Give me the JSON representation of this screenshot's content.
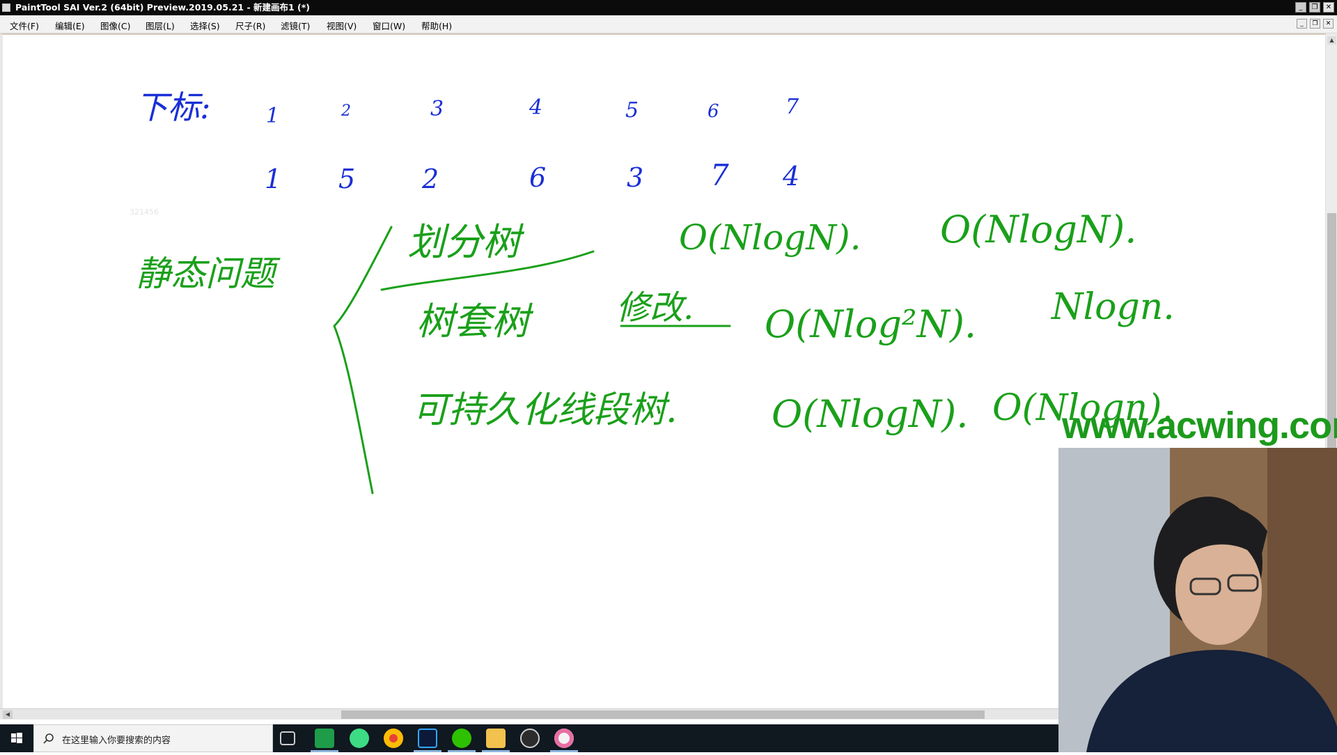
{
  "window": {
    "title": "PaintTool SAI Ver.2 (64bit) Preview.2019.05.21 - 新建画布1 (*)",
    "minimize_label": "_",
    "restore_label": "❐",
    "close_label": "✕"
  },
  "menu": {
    "items": [
      "文件(F)",
      "编辑(E)",
      "图像(C)",
      "图层(L)",
      "选择(S)",
      "尺子(R)",
      "滤镜(T)",
      "视图(V)",
      "窗口(W)",
      "帮助(H)"
    ]
  },
  "canvas": {
    "ink_color": "#1aa01a",
    "blue_ink_color": "#1a2fd6",
    "row1_label": "下标:",
    "row1_numbers": [
      "1",
      "2",
      "3",
      "4",
      "5",
      "6",
      "7"
    ],
    "row2_numbers": [
      "1",
      "5",
      "2",
      "6",
      "3",
      "7",
      "4"
    ],
    "faint_number": "321456",
    "static_label": "静态问题",
    "rows": [
      {
        "name": "划分树",
        "complexity": "O(NlogN).",
        "extra": "O(NlogN)."
      },
      {
        "name": "树套树",
        "modifier": "修改.",
        "complexity": "O(Nlog²N).",
        "extra": "Nlogn."
      },
      {
        "name": "可持久化线段树.",
        "complexity": "O(NlogN).",
        "extra": "O(Nlogn)."
      }
    ]
  },
  "watermark": "www.acwing.com",
  "taskbar": {
    "search_placeholder": "在这里输入你要搜索的内容",
    "apps": [
      "task-view-icon",
      "pycharm-icon",
      "android-studio-icon",
      "chrome-icon",
      "photoshop-icon",
      "wechat-icon",
      "file-explorer-icon",
      "obs-icon",
      "painttool-sai-icon"
    ]
  }
}
